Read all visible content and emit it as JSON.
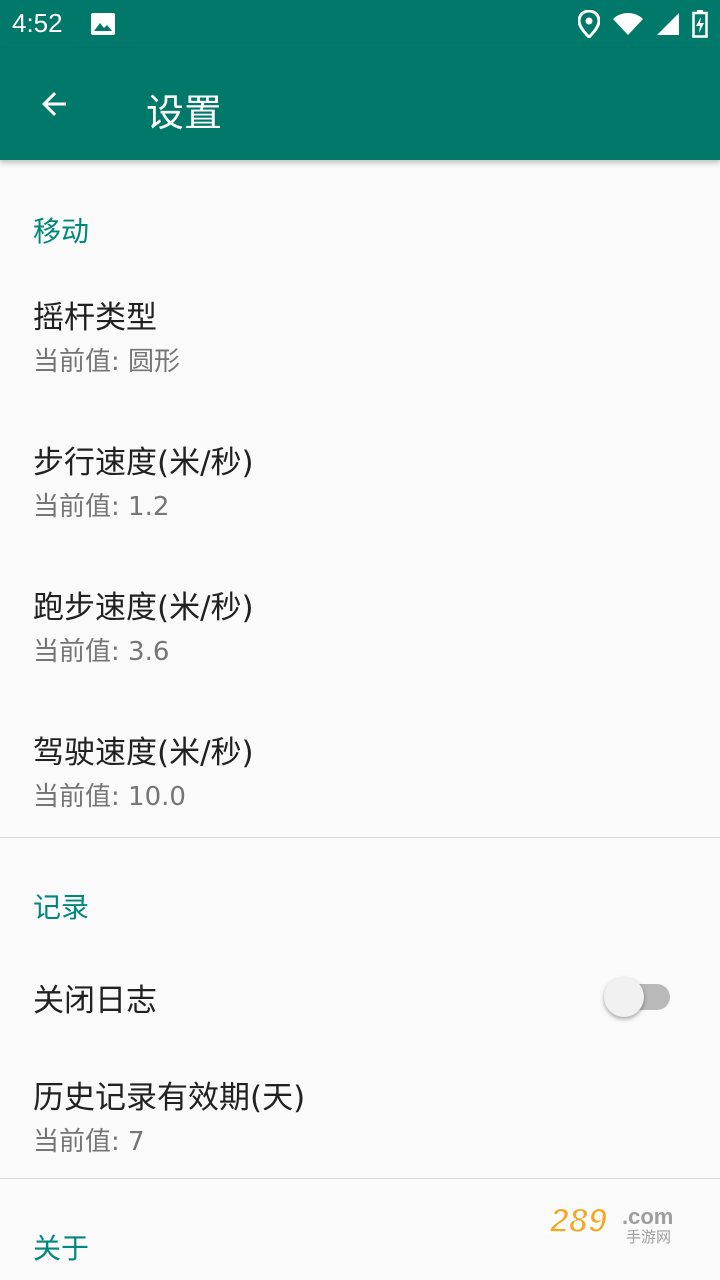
{
  "status_bar": {
    "time": "4:52",
    "icons": [
      "image-icon",
      "location-icon",
      "wifi-icon",
      "signal-icon",
      "battery-icon"
    ]
  },
  "app_bar": {
    "title": "设置",
    "back_icon": "arrow-back-icon"
  },
  "colors": {
    "primary": "#00796b",
    "accent": "#00897b",
    "background": "#fafafa"
  },
  "sections": {
    "movement": {
      "header": "移动",
      "items": [
        {
          "title": "摇杆类型",
          "summary": "当前值: 圆形"
        },
        {
          "title": "步行速度(米/秒)",
          "summary": "当前值: 1.2"
        },
        {
          "title": "跑步速度(米/秒)",
          "summary": "当前值: 3.6"
        },
        {
          "title": "驾驶速度(米/秒)",
          "summary": "当前值: 10.0"
        }
      ]
    },
    "record": {
      "header": "记录",
      "close_log": {
        "title": "关闭日志",
        "enabled": false
      },
      "history": {
        "title": "历史记录有效期(天)",
        "summary": "当前值: 7"
      }
    },
    "about": {
      "header": "关于"
    }
  },
  "watermark": {
    "text": "289.com",
    "subtext": "手游网"
  }
}
